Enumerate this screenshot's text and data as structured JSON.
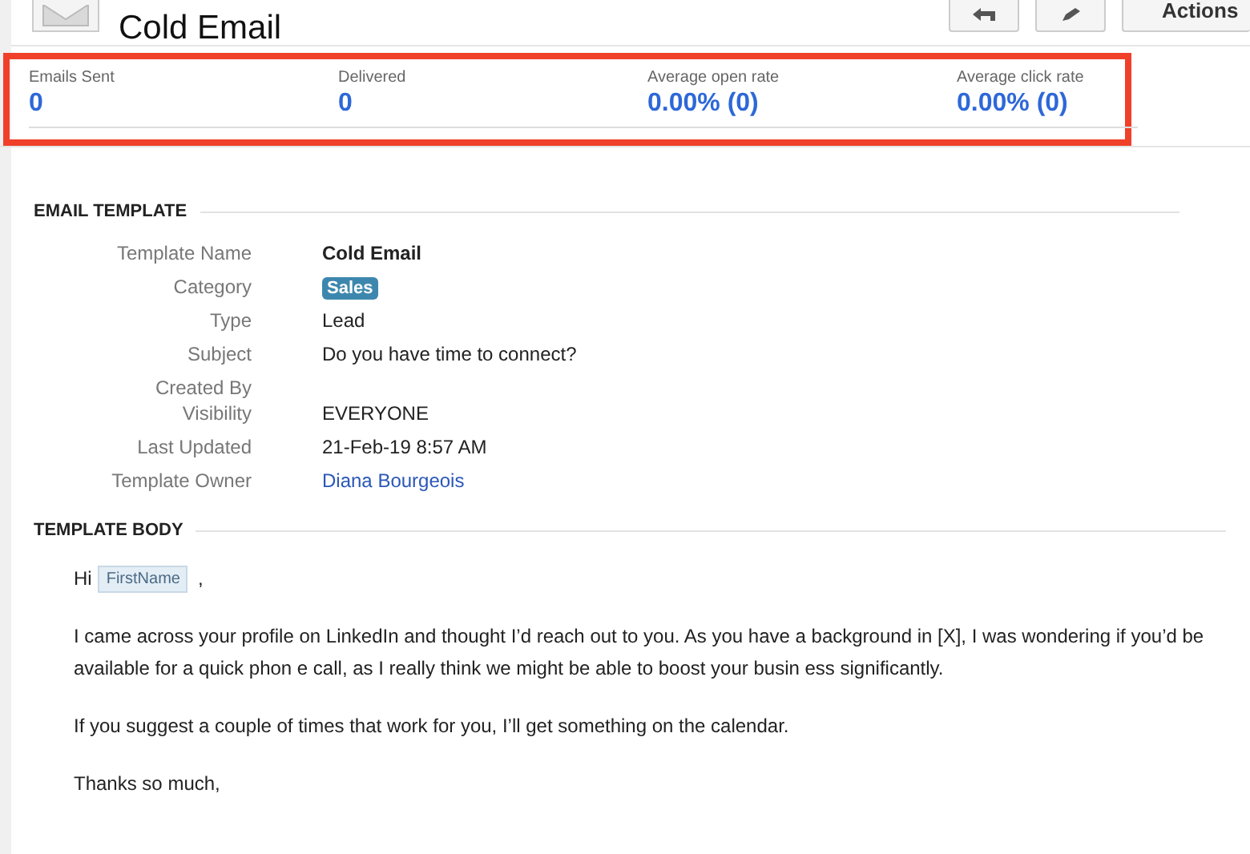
{
  "header": {
    "title": "Cold Email",
    "buttons": [
      {
        "kind": "reply"
      },
      {
        "kind": "edit"
      },
      {
        "kind": "menu",
        "label": "Actions"
      }
    ]
  },
  "stats": [
    {
      "label": "Emails Sent",
      "value": "0"
    },
    {
      "label": "Delivered",
      "value": "0"
    },
    {
      "label": "Average open rate",
      "value": "0.00% (0)"
    },
    {
      "label": "Average click rate",
      "value": "0.00% (0)"
    }
  ],
  "email_template": {
    "heading": "EMAIL TEMPLATE",
    "fields": [
      {
        "label": "Template Name",
        "value": "Cold Email",
        "kind": "bold"
      },
      {
        "label": "Category",
        "value": "Sales",
        "kind": "tag"
      },
      {
        "label": "Type",
        "value": "Lead",
        "kind": "text"
      },
      {
        "label": "Subject",
        "value": "Do you have time to connect?",
        "kind": "text"
      },
      {
        "label": "Created By",
        "kind": "empty"
      },
      {
        "label": "Visibility",
        "value": "EVERYONE",
        "kind": "text"
      },
      {
        "label": "Last Updated",
        "value": "21-Feb-19 8:57 AM",
        "kind": "text"
      },
      {
        "label": "Template Owner",
        "value": "Diana Bourgeois",
        "kind": "link"
      }
    ]
  },
  "template_body": {
    "heading": "TEMPLATE BODY",
    "greeting": {
      "text": "Hi",
      "merge_field": "FirstName",
      "suffix": ","
    },
    "paragraphs": [
      "I came across your profile on LinkedIn and thought I’d reach out to you. As you have a background in [X], I was wondering if you’d be available for a quick phon e call, as I really think we might be able to boost your busin ess significantly.",
      "If you suggest a couple of times that work for you, I’ll get something on the calendar.",
      "Thanks so much,"
    ]
  }
}
